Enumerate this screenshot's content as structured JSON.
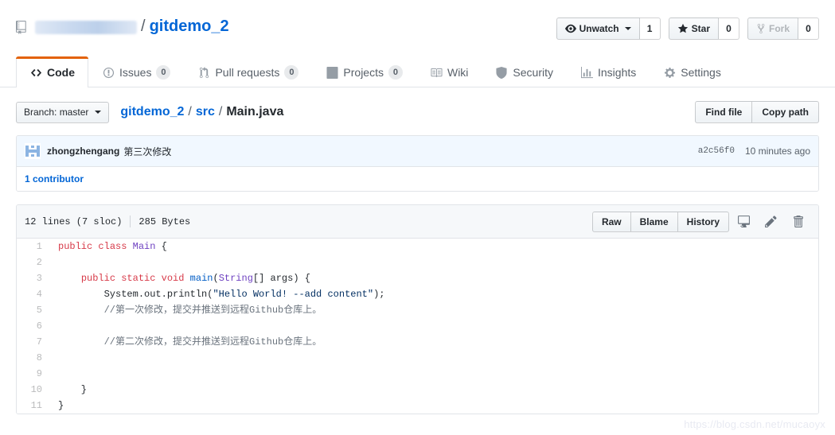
{
  "repo": {
    "owner_redacted": "",
    "separator": "/",
    "name": "gitdemo_2",
    "icon": "repo-icon"
  },
  "actions": {
    "watch": {
      "label": "Unwatch",
      "count": "1",
      "icon": "eye-icon"
    },
    "star": {
      "label": "Star",
      "count": "0",
      "icon": "star-icon"
    },
    "fork": {
      "label": "Fork",
      "count": "0",
      "icon": "fork-icon"
    }
  },
  "nav": {
    "tabs": [
      {
        "label": "Code",
        "count": null,
        "icon": "code-icon",
        "selected": true
      },
      {
        "label": "Issues",
        "count": "0",
        "icon": "issue-opened-icon",
        "selected": false
      },
      {
        "label": "Pull requests",
        "count": "0",
        "icon": "git-pull-request-icon",
        "selected": false
      },
      {
        "label": "Projects",
        "count": "0",
        "icon": "project-icon",
        "selected": false
      },
      {
        "label": "Wiki",
        "count": null,
        "icon": "book-icon",
        "selected": false
      },
      {
        "label": "Security",
        "count": null,
        "icon": "shield-icon",
        "selected": false
      },
      {
        "label": "Insights",
        "count": null,
        "icon": "graph-icon",
        "selected": false
      },
      {
        "label": "Settings",
        "count": null,
        "icon": "gear-icon",
        "selected": false
      }
    ]
  },
  "pathbar": {
    "branch_label": "Branch: master",
    "breadcrumb": {
      "root": "gitdemo_2",
      "sep1": "/",
      "dir": "src",
      "sep2": "/",
      "file": "Main.java"
    },
    "find_file": "Find file",
    "copy_path": "Copy path"
  },
  "commit": {
    "author": "zhongzhengang",
    "message": "第三次修改",
    "sha": "a2c56f0",
    "time": "10 minutes ago",
    "contributors": "1 contributor"
  },
  "file": {
    "lines_info": "12 lines (7 sloc)",
    "size": "285 Bytes",
    "buttons": {
      "raw": "Raw",
      "blame": "Blame",
      "history": "History"
    },
    "icons": {
      "desktop": "desktop-download-icon",
      "edit": "pencil-icon",
      "delete": "trash-icon"
    }
  },
  "code": {
    "lines": [
      {
        "n": "1",
        "tokens": [
          {
            "t": "k",
            "v": "public"
          },
          {
            "t": "",
            "v": " "
          },
          {
            "t": "k",
            "v": "class"
          },
          {
            "t": "",
            "v": " "
          },
          {
            "t": "t",
            "v": "Main"
          },
          {
            "t": "",
            "v": " {"
          }
        ]
      },
      {
        "n": "2",
        "tokens": []
      },
      {
        "n": "3",
        "tokens": [
          {
            "t": "",
            "v": "    "
          },
          {
            "t": "k",
            "v": "public"
          },
          {
            "t": "",
            "v": " "
          },
          {
            "t": "k",
            "v": "static"
          },
          {
            "t": "",
            "v": " "
          },
          {
            "t": "k",
            "v": "void"
          },
          {
            "t": "",
            "v": " "
          },
          {
            "t": "fn",
            "v": "main"
          },
          {
            "t": "",
            "v": "("
          },
          {
            "t": "t",
            "v": "String"
          },
          {
            "t": "",
            "v": "[] args) {"
          }
        ]
      },
      {
        "n": "4",
        "tokens": [
          {
            "t": "",
            "v": "        System.out.println("
          },
          {
            "t": "s",
            "v": "\"Hello World! --add content\""
          },
          {
            "t": "",
            "v": ");"
          }
        ]
      },
      {
        "n": "5",
        "tokens": [
          {
            "t": "c",
            "v": "        //第一次修改，提交并推送到远程Github仓库上。"
          }
        ]
      },
      {
        "n": "6",
        "tokens": []
      },
      {
        "n": "7",
        "tokens": [
          {
            "t": "c",
            "v": "        //第二次修改，提交并推送到远程Github仓库上。"
          }
        ]
      },
      {
        "n": "8",
        "tokens": []
      },
      {
        "n": "9",
        "tokens": []
      },
      {
        "n": "10",
        "tokens": [
          {
            "t": "",
            "v": "    }"
          }
        ]
      },
      {
        "n": "11",
        "tokens": [
          {
            "t": "",
            "v": "}"
          }
        ]
      }
    ]
  },
  "watermark": "https://blog.csdn.net/mucaoyx",
  "colors": {
    "accent_orange": "#e36209",
    "link_blue": "#0366d6",
    "commit_bg": "#f1f8ff",
    "border": "#e1e4e8"
  }
}
